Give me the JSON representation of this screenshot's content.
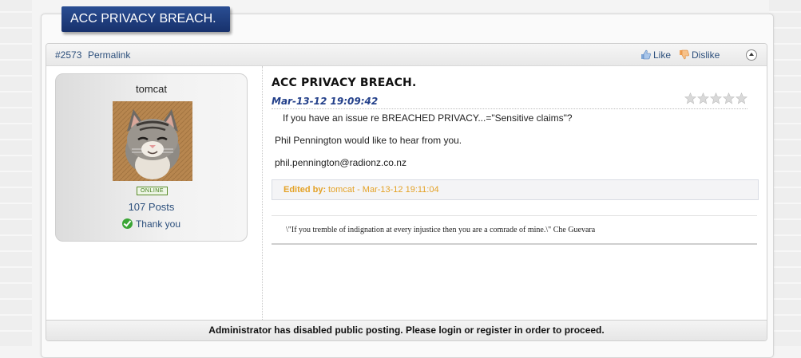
{
  "topic": {
    "title": "ACC PRIVACY BREACH."
  },
  "post": {
    "number": "#2573",
    "permalink_label": "Permalink",
    "like_label": "Like",
    "dislike_label": "Dislike",
    "title": "ACC PRIVACY BREACH.",
    "date": "Mar-13-12 19:09:42",
    "rating": {
      "value": 0,
      "max": 5
    },
    "body": [
      "If you have an issue re BREACHED PRIVACY...=\"Sensitive claims\"?",
      "Phil Pennington would like to hear from you.",
      "phil.pennington@radionz.co.nz"
    ],
    "edited_label": "Edited by:",
    "edited_value": "tomcat - Mar-13-12 19:11:04",
    "signature": "\\\"If you tremble of indignation at every injustice then you are a comrade of mine.\\\" Che Guevara"
  },
  "user": {
    "name": "tomcat",
    "status": "ONLINE",
    "posts_count": "107",
    "posts_label": "Posts",
    "thank_label": "Thank you"
  },
  "footer": {
    "message": "Administrator has disabled public posting. Please login or register in order to proceed."
  },
  "colors": {
    "accent": "#1f3f82",
    "link": "#2c4f7c",
    "edited": "#e4a227",
    "online": "#3f7a16"
  },
  "icons": [
    "like-thumb-icon",
    "dislike-thumb-icon",
    "collapse-icon",
    "star-icon",
    "check-icon"
  ]
}
